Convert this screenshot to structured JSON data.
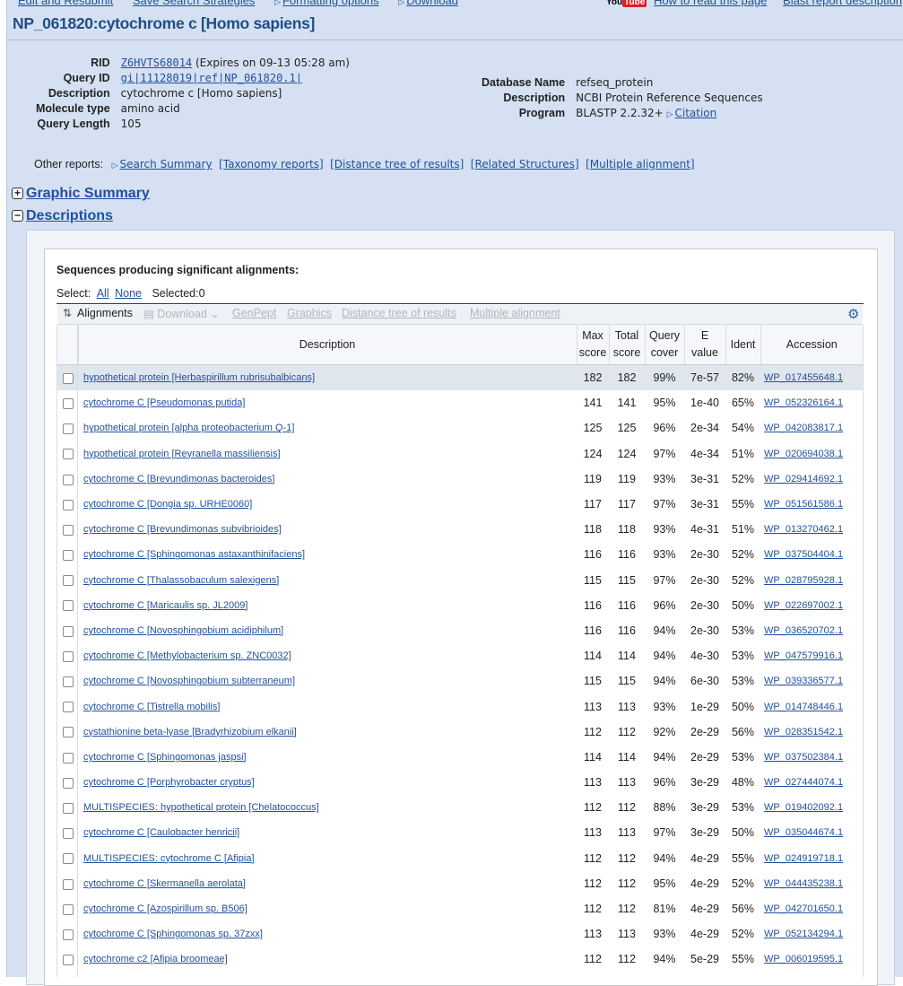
{
  "top_nav": {
    "left_links": [
      "Edit and Resubmit",
      "Save Search Strategies",
      "Formatting options",
      "Download"
    ],
    "youtube_label": "You",
    "youtube_badge": "Tube",
    "right_links": [
      "How to read this page",
      "Blast report description"
    ]
  },
  "page_title": "NP_061820:cytochrome c [Homo sapiens]",
  "meta_left": [
    {
      "key": "RID",
      "link": "Z6HVTS68014",
      "value": "(Expires on 09-13 05:28 am)"
    },
    {
      "key": "Query ID",
      "link": "gi|11128019|ref|NP_061820.1|",
      "value": ""
    },
    {
      "key": "Description",
      "link": "",
      "value": "cytochrome c [Homo sapiens]"
    },
    {
      "key": "Molecule type",
      "link": "",
      "value": "amino acid"
    },
    {
      "key": "Query Length",
      "link": "",
      "value": "105"
    }
  ],
  "meta_right": [
    {
      "key": "Database Name",
      "value": "refseq_protein",
      "link": ""
    },
    {
      "key": "Description",
      "value": "NCBI Protein Reference Sequences",
      "link": ""
    },
    {
      "key": "Program",
      "value": "BLASTP 2.2.32+",
      "link": "Citation"
    }
  ],
  "other_reports": {
    "label": "Other reports:",
    "links": [
      "Search Summary",
      "[Taxonomy reports]",
      "[Distance tree of results]",
      "[Related Structures]",
      "[Multiple alignment]"
    ]
  },
  "sections": {
    "graphic_summary": "Graphic Summary",
    "descriptions": "Descriptions"
  },
  "descriptions_panel": {
    "heading": "Sequences producing significant alignments:",
    "select_label": "Select:",
    "select_all": "All",
    "select_none": "None",
    "selected_count": "Selected:0"
  },
  "toolbar": {
    "alignments": "Alignments",
    "download": "Download",
    "genpept": "GenPept",
    "graphics": "Graphics",
    "distance_tree": "Distance tree of results",
    "multiple_alignment": "Multiple alignment",
    "settings_icon": "gear-icon"
  },
  "table": {
    "headers": {
      "description": "Description",
      "max_score": [
        "Max",
        "score"
      ],
      "total_score": [
        "Total",
        "score"
      ],
      "query_cover": [
        "Query",
        "cover"
      ],
      "e_value": [
        "E",
        "value"
      ],
      "ident": "Ident",
      "accession": "Accession"
    },
    "rows": [
      {
        "desc": "hypothetical protein [Herbaspirillum rubrisubalbicans]",
        "max": "182",
        "total": "182",
        "cover": "99%",
        "e": "7e-57",
        "ident": "82%",
        "acc": "WP_017455648.1"
      },
      {
        "desc": "cytochrome C [Pseudomonas putida]",
        "max": "141",
        "total": "141",
        "cover": "95%",
        "e": "1e-40",
        "ident": "65%",
        "acc": "WP_052326164.1"
      },
      {
        "desc": "hypothetical protein [alpha proteobacterium Q-1]",
        "max": "125",
        "total": "125",
        "cover": "96%",
        "e": "2e-34",
        "ident": "54%",
        "acc": "WP_042083817.1"
      },
      {
        "desc": "hypothetical protein [Reyranella massiliensis]",
        "max": "124",
        "total": "124",
        "cover": "97%",
        "e": "4e-34",
        "ident": "51%",
        "acc": "WP_020694038.1"
      },
      {
        "desc": "cytochrome C [Brevundimonas bacteroides]",
        "max": "119",
        "total": "119",
        "cover": "93%",
        "e": "3e-31",
        "ident": "52%",
        "acc": "WP_029414692.1"
      },
      {
        "desc": "cytochrome C [Dongia sp. URHE0060]",
        "max": "117",
        "total": "117",
        "cover": "97%",
        "e": "3e-31",
        "ident": "55%",
        "acc": "WP_051561586.1"
      },
      {
        "desc": "cytochrome C [Brevundimonas subvibrioides]",
        "max": "118",
        "total": "118",
        "cover": "93%",
        "e": "4e-31",
        "ident": "51%",
        "acc": "WP_013270462.1"
      },
      {
        "desc": "cytochrome C [Sphingomonas astaxanthinifaciens]",
        "max": "116",
        "total": "116",
        "cover": "93%",
        "e": "2e-30",
        "ident": "52%",
        "acc": "WP_037504404.1"
      },
      {
        "desc": "cytochrome C [Thalassobaculum salexigens]",
        "max": "115",
        "total": "115",
        "cover": "97%",
        "e": "2e-30",
        "ident": "52%",
        "acc": "WP_028795928.1"
      },
      {
        "desc": "cytochrome C [Maricaulis sp. JL2009]",
        "max": "116",
        "total": "116",
        "cover": "96%",
        "e": "2e-30",
        "ident": "50%",
        "acc": "WP_022697002.1"
      },
      {
        "desc": "cytochrome C [Novosphingobium acidiphilum]",
        "max": "116",
        "total": "116",
        "cover": "94%",
        "e": "2e-30",
        "ident": "53%",
        "acc": "WP_036520702.1"
      },
      {
        "desc": "cytochrome C [Methylobacterium sp. ZNC0032]",
        "max": "114",
        "total": "114",
        "cover": "94%",
        "e": "4e-30",
        "ident": "53%",
        "acc": "WP_047579916.1"
      },
      {
        "desc": "cytochrome C [Novosphingobium subterraneum]",
        "max": "115",
        "total": "115",
        "cover": "94%",
        "e": "6e-30",
        "ident": "53%",
        "acc": "WP_039336577.1"
      },
      {
        "desc": "cytochrome C [Tistrella mobilis]",
        "max": "113",
        "total": "113",
        "cover": "93%",
        "e": "1e-29",
        "ident": "50%",
        "acc": "WP_014748446.1"
      },
      {
        "desc": "cystathionine beta-lyase [Bradyrhizobium elkanii]",
        "max": "112",
        "total": "112",
        "cover": "92%",
        "e": "2e-29",
        "ident": "56%",
        "acc": "WP_028351542.1"
      },
      {
        "desc": "cytochrome C [Sphingomonas jaspsi]",
        "max": "114",
        "total": "114",
        "cover": "94%",
        "e": "2e-29",
        "ident": "53%",
        "acc": "WP_037502384.1"
      },
      {
        "desc": "cytochrome C [Porphyrobacter cryptus]",
        "max": "113",
        "total": "113",
        "cover": "96%",
        "e": "3e-29",
        "ident": "48%",
        "acc": "WP_027444074.1"
      },
      {
        "desc": "MULTISPECIES: hypothetical protein [Chelatococcus]",
        "max": "112",
        "total": "112",
        "cover": "88%",
        "e": "3e-29",
        "ident": "53%",
        "acc": "WP_019402092.1"
      },
      {
        "desc": "cytochrome C [Caulobacter henricii]",
        "max": "113",
        "total": "113",
        "cover": "97%",
        "e": "3e-29",
        "ident": "50%",
        "acc": "WP_035044674.1"
      },
      {
        "desc": "MULTISPECIES: cytochrome C [Afipia]",
        "max": "112",
        "total": "112",
        "cover": "94%",
        "e": "4e-29",
        "ident": "55%",
        "acc": "WP_024919718.1"
      },
      {
        "desc": "cytochrome C [Skermanella aerolata]",
        "max": "112",
        "total": "112",
        "cover": "95%",
        "e": "4e-29",
        "ident": "52%",
        "acc": "WP_044435238.1"
      },
      {
        "desc": "cytochrome C [Azospirillum sp. B506]",
        "max": "112",
        "total": "112",
        "cover": "81%",
        "e": "4e-29",
        "ident": "56%",
        "acc": "WP_042701650.1"
      },
      {
        "desc": "cytochrome C [Sphingomonas sp. 37zxx]",
        "max": "113",
        "total": "113",
        "cover": "93%",
        "e": "4e-29",
        "ident": "52%",
        "acc": "WP_052134294.1"
      },
      {
        "desc": "cytochrome c2 [Afipia broomeae]",
        "max": "112",
        "total": "112",
        "cover": "94%",
        "e": "5e-29",
        "ident": "55%",
        "acc": "WP_006019595.1"
      }
    ]
  },
  "colors": {
    "page_bg": "#d5e1f2",
    "title": "#1f4e86",
    "link": "#2250a0",
    "highlight_row": "#dfe6ee"
  }
}
